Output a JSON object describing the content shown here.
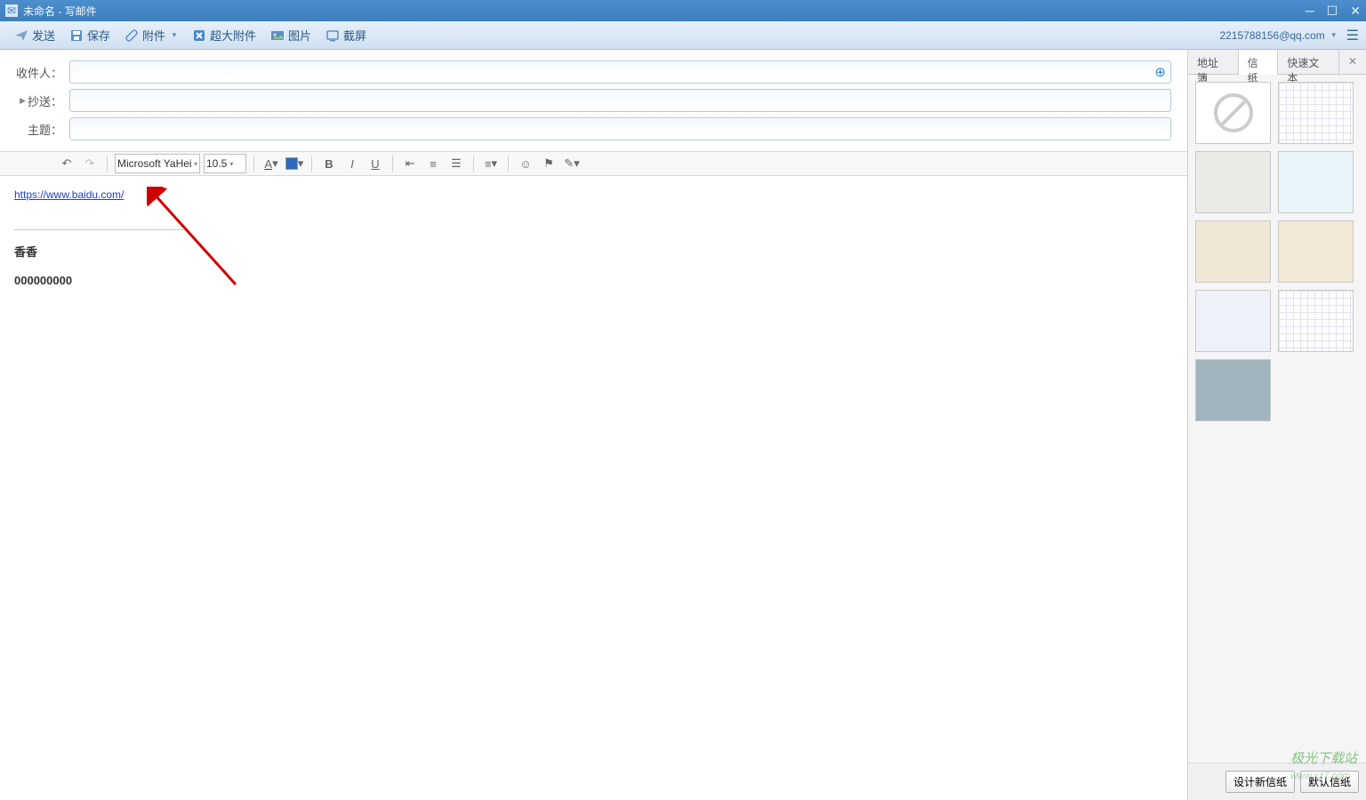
{
  "window_title": "未命名 - 写邮件",
  "toolbar": {
    "send": "发送",
    "save": "保存",
    "attach": "附件",
    "big_attach": "超大附件",
    "image": "图片",
    "screenshot": "截屏",
    "account": "2215788156@qq.com"
  },
  "fields": {
    "to_label": "收件人：",
    "cc_label": "抄送：",
    "subject_label": "主题：",
    "to_value": "",
    "cc_value": "",
    "subject_value": ""
  },
  "format": {
    "font": "Microsoft YaHei",
    "size": "10.5"
  },
  "body": {
    "link_text": "https://www.baidu.com/",
    "sig_name": "香香",
    "sig_phone": "000000000"
  },
  "right_panel": {
    "tab_contacts": "地址簿",
    "tab_stationery": "信纸",
    "tab_quicktext": "快速文本",
    "btn_design": "设计新信纸",
    "btn_default": "默认信纸"
  },
  "watermark": "极光下载站"
}
